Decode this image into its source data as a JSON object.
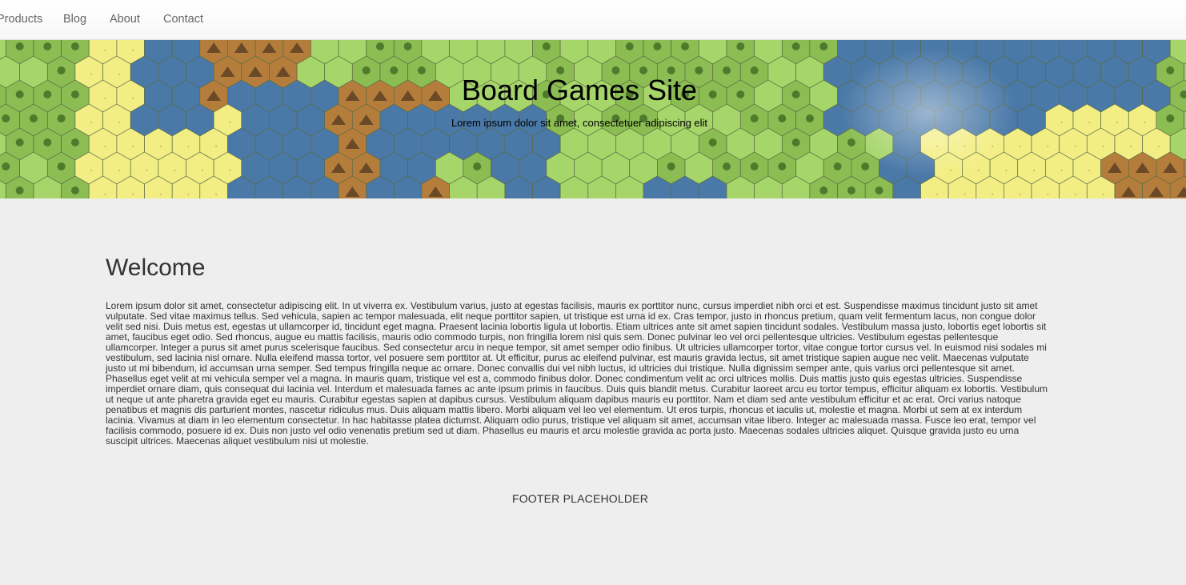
{
  "nav": {
    "items": [
      {
        "label": "Products"
      },
      {
        "label": "Blog"
      },
      {
        "label": "About"
      },
      {
        "label": "Contact"
      }
    ],
    "stray_mark": "`"
  },
  "banner": {
    "title": "Board Games Site",
    "subtitle": "Lorem ipsum dolor sit amet, consectetuer adipiscing elit"
  },
  "main": {
    "heading": "Welcome",
    "body": "Lorem ipsum dolor sit amet, consectetur adipiscing elit. In ut viverra ex. Vestibulum varius, justo at egestas facilisis, mauris ex porttitor nunc, cursus imperdiet nibh orci et est. Suspendisse maximus tincidunt justo sit amet vulputate. Sed vitae maximus tellus. Sed vehicula, sapien ac tempor malesuada, elit neque porttitor sapien, ut tristique est urna id ex. Cras tempor, justo in rhoncus pretium, quam velit fermentum lacus, non congue dolor velit sed nisi. Duis metus est, egestas ut ullamcorper id, tincidunt eget magna. Praesent lacinia lobortis ligula ut lobortis. Etiam ultrices ante sit amet sapien tincidunt sodales. Vestibulum massa justo, lobortis eget lobortis sit amet, faucibus eget odio. Sed rhoncus, augue eu mattis facilisis, mauris odio commodo turpis, non fringilla lorem nisl quis sem. Donec pulvinar leo vel orci pellentesque ultricies. Vestibulum egestas pellentesque ullamcorper. Integer a purus sit amet purus scelerisque faucibus. Sed consectetur arcu in neque tempor, sit amet semper odio finibus. Ut ultricies ullamcorper tortor, vitae congue tortor cursus vel. In euismod nisi sodales mi vestibulum, sed lacinia nisl ornare. Nulla eleifend massa tortor, vel posuere sem porttitor at. Ut efficitur, purus ac eleifend pulvinar, est mauris gravida lectus, sit amet tristique sapien augue nec velit. Maecenas vulputate justo ut mi bibendum, id accumsan urna semper. Sed tempus fringilla neque ac ornare. Donec convallis dui vel nibh luctus, id ultricies dui tristique. Nulla dignissim semper ante, quis varius orci pellentesque sit amet. Phasellus eget velit at mi vehicula semper vel a magna. In mauris quam, tristique vel est a, commodo finibus dolor. Donec condimentum velit ac orci ultrices mollis. Duis mattis justo quis egestas ultricies. Suspendisse imperdiet ornare diam, quis consequat dui lacinia vel. Interdum et malesuada fames ac ante ipsum primis in faucibus. Duis quis blandit metus. Curabitur laoreet arcu eu tortor tempus, efficitur aliquam ex lobortis. Vestibulum ut neque ut ante pharetra gravida eget eu mauris. Curabitur egestas sapien at dapibus cursus. Vestibulum aliquam dapibus mauris eu porttitor. Nam et diam sed ante vestibulum efficitur et ac erat. Orci varius natoque penatibus et magnis dis parturient montes, nascetur ridiculus mus. Duis aliquam mattis libero. Morbi aliquam vel leo vel elementum. Ut eros turpis, rhoncus et iaculis ut, molestie et magna. Morbi ut sem at ex interdum lacinia. Vivamus at diam in leo elementum consectetur. In hac habitasse platea dictumst. Aliquam odio purus, tristique vel aliquam sit amet, accumsan vitae libero. Integer ac malesuada massa. Fusce leo erat, tempor vel facilisis commodo, posuere id ex. Duis non justo vel odio venenatis pretium sed ut diam. Phasellus eu mauris et arcu molestie gravida ac porta justo. Maecenas sodales ultricies aliquet. Quisque gravida justo eu urna suscipit ultrices. Maecenas aliquet vestibulum nisi ut molestie."
  },
  "footer": {
    "text": "FOOTER PLACEHOLDER"
  },
  "colors": {
    "background": "#eeeeee",
    "water": "#4a79a8",
    "forest": "#8bbd52",
    "grass": "#a6d56a",
    "mountain": "#b57d3c",
    "desert": "#f3ee84"
  }
}
